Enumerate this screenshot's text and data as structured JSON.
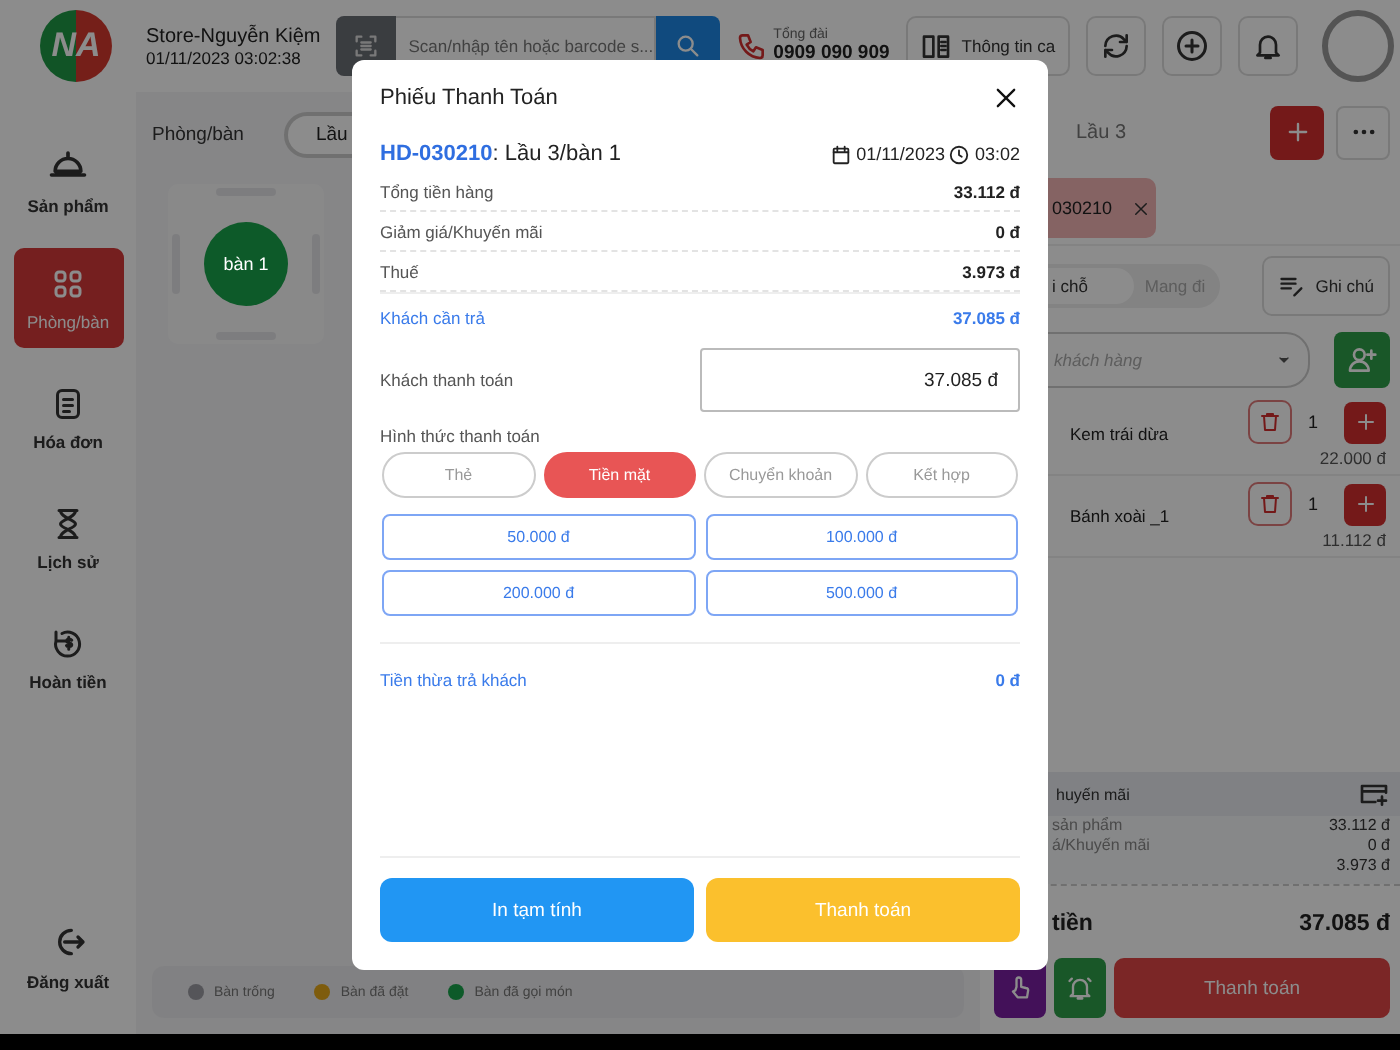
{
  "header": {
    "logo": "NA",
    "store_name": "Store-Nguyễn Kiệm",
    "datetime": "01/11/2023 03:02:38",
    "search": {
      "placeholder": "Scan/nhập tên hoặc barcode s..."
    },
    "hotline": {
      "label": "Tổng đài",
      "number": "0909 090 909"
    },
    "shift_button": "Thông tin ca"
  },
  "sidebar": {
    "items": [
      {
        "label": "Sản phẩm",
        "selected": false
      },
      {
        "label": "Phòng/bàn",
        "selected": true
      },
      {
        "label": "Hóa đơn",
        "selected": false
      },
      {
        "label": "Lịch sử",
        "selected": false
      },
      {
        "label": "Hoàn tiền",
        "selected": false
      }
    ],
    "logout": "Đăng xuất"
  },
  "room_panel": {
    "title": "Phòng/bàn",
    "floor_tab": "Lầu",
    "tables": [
      {
        "label": "bàn 1",
        "color": "#0d5a29"
      }
    ],
    "legend": [
      {
        "label": "Bàn trống",
        "color": "#555559"
      },
      {
        "label": "Bàn đã đặt",
        "color": "#7e5c0d"
      },
      {
        "label": "Bàn đã gọi món",
        "color": "#0d5a29"
      }
    ]
  },
  "order_panel": {
    "floor_label": "Lầu 3",
    "order_tab": "030210",
    "service_tabs": [
      {
        "label": "i chỗ",
        "selected": true
      },
      {
        "label": "Mang đi",
        "selected": false
      }
    ],
    "note_button": "Ghi chú",
    "customer": {
      "placeholder": "khách hàng"
    },
    "items": [
      {
        "name": "Kem trái dừa",
        "qty": "1",
        "price": "22.000 đ"
      },
      {
        "name": "Bánh xoài _1",
        "qty": "1",
        "price": "11.112 đ"
      }
    ],
    "summary": {
      "title": "huyến mãi",
      "lines": [
        {
          "label": "sản phẩm",
          "value": "33.112 đ"
        },
        {
          "label": "á/Khuyến mãi",
          "value": "0 đ"
        },
        {
          "value": "3.973 đ"
        }
      ]
    },
    "total": {
      "label": "tiền",
      "value": "37.085 đ"
    },
    "pay_button": "Thanh toán"
  },
  "modal": {
    "title": "Phiếu Thanh Toán",
    "invoice": {
      "code": "HD-030210",
      "place": ": Lầu 3/bàn 1",
      "date": "01/11/2023",
      "time": "03:02"
    },
    "lines": [
      {
        "label": "Tổng tiền hàng",
        "value": "33.112 đ",
        "kind": "plain"
      },
      {
        "label": "Giảm giá/Khuyến mãi",
        "value": "0 đ",
        "kind": "plain"
      },
      {
        "label": "Thuế",
        "value": "3.973 đ",
        "kind": "plain"
      },
      {
        "label": "Khách cần trả",
        "value": "37.085 đ",
        "kind": "due"
      }
    ],
    "paid": {
      "label": "Khách thanh toán",
      "value": "37.085 đ"
    },
    "method_label": "Hình thức thanh toán",
    "methods": [
      {
        "label": "Thẻ",
        "selected": false
      },
      {
        "label": "Tiền mặt",
        "selected": true
      },
      {
        "label": "Chuyển khoản",
        "selected": false
      },
      {
        "label": "Kết hợp",
        "selected": false
      }
    ],
    "quick_amounts": [
      "50.000 đ",
      "100.000 đ",
      "200.000 đ",
      "500.000 đ"
    ],
    "change": {
      "label": "Tiền thừa trả khách",
      "value": "0 đ"
    },
    "buttons": [
      {
        "label": "In tạm tính",
        "kind": "print"
      },
      {
        "label": "Thanh toán",
        "kind": "pay"
      }
    ]
  }
}
